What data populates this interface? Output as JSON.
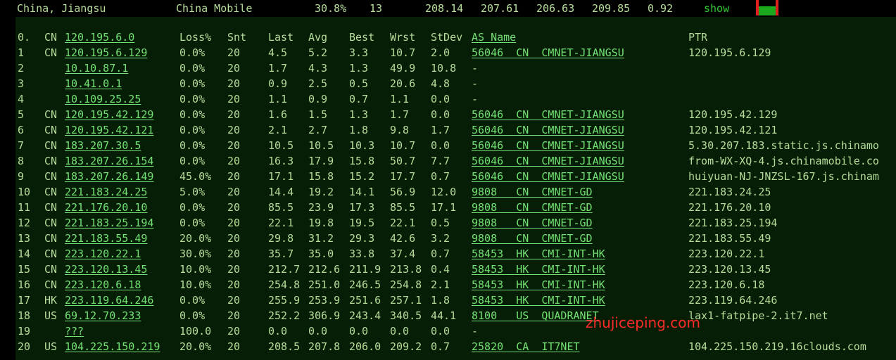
{
  "topbar": {
    "location": "China, Jiangsu",
    "isp": "China Mobile",
    "loss": "30.8%",
    "snt": "13",
    "last": "208.14",
    "avg": "207.61",
    "best": "206.63",
    "wrst": "209.85",
    "stdev": "0.92",
    "show_label": "show",
    "meter_level": 0.6
  },
  "headers": {
    "hop": "0.",
    "cc": "CN",
    "ip": "120.195.6.0",
    "loss": "Loss%",
    "snt": "Snt",
    "last": "Last",
    "avg": "Avg",
    "best": "Best",
    "wrst": "Wrst",
    "stdev": "StDev",
    "as_name": "AS Name",
    "ptr": "PTR"
  },
  "rows": [
    {
      "hop": "1",
      "cc": "CN",
      "ip": "120.195.6.129",
      "loss": "0.0%",
      "snt": "20",
      "last": "4.5",
      "avg": "5.2",
      "best": "3.3",
      "wrst": "10.7",
      "stdev": "2.0",
      "as_name": "56046  CN  CMNET-JIANGSU",
      "ptr": "120.195.6.129"
    },
    {
      "hop": "2",
      "cc": "",
      "ip": "10.10.87.1",
      "loss": "0.0%",
      "snt": "20",
      "last": "1.7",
      "avg": "4.3",
      "best": "1.3",
      "wrst": "49.9",
      "stdev": "10.8",
      "as_name": "-",
      "ptr": ""
    },
    {
      "hop": "3",
      "cc": "",
      "ip": "10.41.0.1",
      "loss": "0.0%",
      "snt": "20",
      "last": "0.9",
      "avg": "2.5",
      "best": "0.5",
      "wrst": "20.6",
      "stdev": "4.8",
      "as_name": "-",
      "ptr": ""
    },
    {
      "hop": "4",
      "cc": "",
      "ip": "10.109.25.25",
      "loss": "0.0%",
      "snt": "20",
      "last": "1.1",
      "avg": "0.9",
      "best": "0.7",
      "wrst": "1.1",
      "stdev": "0.0",
      "as_name": "-",
      "ptr": ""
    },
    {
      "hop": "5",
      "cc": "CN",
      "ip": "120.195.42.129",
      "loss": "0.0%",
      "snt": "20",
      "last": "1.6",
      "avg": "1.5",
      "best": "1.3",
      "wrst": "1.7",
      "stdev": "0.0",
      "as_name": "56046  CN  CMNET-JIANGSU",
      "ptr": "120.195.42.129"
    },
    {
      "hop": "6",
      "cc": "CN",
      "ip": "120.195.42.121",
      "loss": "0.0%",
      "snt": "20",
      "last": "2.1",
      "avg": "2.7",
      "best": "1.8",
      "wrst": "9.8",
      "stdev": "1.7",
      "as_name": "56046  CN  CMNET-JIANGSU",
      "ptr": "120.195.42.121"
    },
    {
      "hop": "7",
      "cc": "CN",
      "ip": "183.207.30.5",
      "loss": "0.0%",
      "snt": "20",
      "last": "10.5",
      "avg": "10.5",
      "best": "10.3",
      "wrst": "10.7",
      "stdev": "0.0",
      "as_name": "56046  CN  CMNET-JIANGSU",
      "ptr": "5.30.207.183.static.js.chinamo"
    },
    {
      "hop": "8",
      "cc": "CN",
      "ip": "183.207.26.154",
      "loss": "0.0%",
      "snt": "20",
      "last": "16.3",
      "avg": "17.9",
      "best": "15.8",
      "wrst": "50.7",
      "stdev": "7.7",
      "as_name": "56046  CN  CMNET-JIANGSU",
      "ptr": "from-WX-XQ-4.js.chinamobile.co"
    },
    {
      "hop": "9",
      "cc": "CN",
      "ip": "183.207.26.149",
      "loss": "45.0%",
      "snt": "20",
      "last": "17.1",
      "avg": "15.8",
      "best": "15.2",
      "wrst": "17.7",
      "stdev": "0.7",
      "as_name": "56046  CN  CMNET-JIANGSU",
      "ptr": "huiyuan-NJ-JNZSL-167.js.chinam"
    },
    {
      "hop": "10",
      "cc": "CN",
      "ip": "221.183.24.25",
      "loss": "5.0%",
      "snt": "20",
      "last": "14.4",
      "avg": "19.2",
      "best": "14.1",
      "wrst": "56.9",
      "stdev": "12.0",
      "as_name": "9808   CN  CMNET-GD",
      "ptr": "221.183.24.25"
    },
    {
      "hop": "11",
      "cc": "CN",
      "ip": "221.176.20.10",
      "loss": "0.0%",
      "snt": "20",
      "last": "85.5",
      "avg": "23.9",
      "best": "17.3",
      "wrst": "85.5",
      "stdev": "17.1",
      "as_name": "9808   CN  CMNET-GD",
      "ptr": "221.176.20.10"
    },
    {
      "hop": "12",
      "cc": "CN",
      "ip": "221.183.25.194",
      "loss": "0.0%",
      "snt": "20",
      "last": "22.1",
      "avg": "19.8",
      "best": "19.5",
      "wrst": "22.1",
      "stdev": "0.5",
      "as_name": "9808   CN  CMNET-GD",
      "ptr": "221.183.25.194"
    },
    {
      "hop": "13",
      "cc": "CN",
      "ip": "221.183.55.49",
      "loss": "20.0%",
      "snt": "20",
      "last": "29.8",
      "avg": "31.2",
      "best": "29.3",
      "wrst": "42.6",
      "stdev": "3.2",
      "as_name": "9808   CN  CMNET-GD",
      "ptr": "221.183.55.49"
    },
    {
      "hop": "14",
      "cc": "CN",
      "ip": "223.120.22.1",
      "loss": "30.0%",
      "snt": "20",
      "last": "35.7",
      "avg": "35.0",
      "best": "33.8",
      "wrst": "37.4",
      "stdev": "0.7",
      "as_name": "58453  HK  CMI-INT-HK",
      "ptr": "223.120.22.1"
    },
    {
      "hop": "15",
      "cc": "CN",
      "ip": "223.120.13.45",
      "loss": "10.0%",
      "snt": "20",
      "last": "212.7",
      "avg": "212.6",
      "best": "211.9",
      "wrst": "213.8",
      "stdev": "0.4",
      "as_name": "58453  HK  CMI-INT-HK",
      "ptr": "223.120.13.45"
    },
    {
      "hop": "16",
      "cc": "CN",
      "ip": "223.120.6.18",
      "loss": "10.0%",
      "snt": "20",
      "last": "254.8",
      "avg": "251.0",
      "best": "246.5",
      "wrst": "254.8",
      "stdev": "2.1",
      "as_name": "58453  HK  CMI-INT-HK",
      "ptr": "223.120.6.18"
    },
    {
      "hop": "17",
      "cc": "HK",
      "ip": "223.119.64.246",
      "loss": "0.0%",
      "snt": "20",
      "last": "255.9",
      "avg": "253.9",
      "best": "251.6",
      "wrst": "257.1",
      "stdev": "1.8",
      "as_name": "58453  HK  CMI-INT-HK",
      "ptr": "223.119.64.246"
    },
    {
      "hop": "18",
      "cc": "US",
      "ip": "69.12.70.233",
      "loss": "0.0%",
      "snt": "20",
      "last": "252.2",
      "avg": "306.9",
      "best": "243.4",
      "wrst": "340.5",
      "stdev": "44.1",
      "as_name": "8100   US  QUADRANET",
      "ptr": "lax1-fatpipe-2.it7.net"
    },
    {
      "hop": "19",
      "cc": "",
      "ip": "???",
      "loss": "100.0",
      "snt": "20",
      "last": "0.0",
      "avg": "0.0",
      "best": "0.0",
      "wrst": "0.0",
      "stdev": "0.0",
      "as_name": "-",
      "ptr": ""
    },
    {
      "hop": "20",
      "cc": "US",
      "ip": "104.225.150.219",
      "loss": "20.0%",
      "snt": "20",
      "last": "208.5",
      "avg": "207.8",
      "best": "206.0",
      "wrst": "209.2",
      "stdev": "0.7",
      "as_name": "25820  CA  IT7NET",
      "ptr": "104.225.150.219.16clouds.com"
    }
  ],
  "watermark": "zhujiceping.com",
  "colors": {
    "background": "#000000",
    "panel": "#051e05",
    "text": "#b6dd9a",
    "link_green": "#74e174",
    "show_green": "#2ecc2e",
    "watermark_red": "#ff2a2a"
  }
}
